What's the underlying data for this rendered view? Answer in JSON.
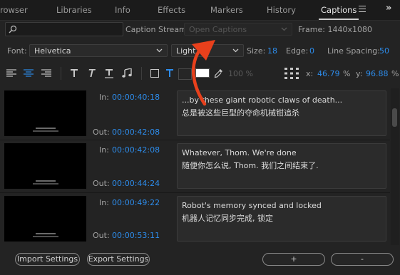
{
  "tabs": [
    {
      "label": "rowser"
    },
    {
      "label": "Libraries"
    },
    {
      "label": "Info"
    },
    {
      "label": "Effects"
    },
    {
      "label": "Markers"
    },
    {
      "label": "History"
    },
    {
      "label": "Captions"
    }
  ],
  "overflow_label": "»",
  "search": {
    "placeholder": ""
  },
  "caption_stream": {
    "label": "Caption Stream:",
    "value": "Open Captions"
  },
  "frame": {
    "label": "Frame:",
    "value": "1440x1080"
  },
  "font": {
    "label": "Font:",
    "family": "Helvetica",
    "style": "Light"
  },
  "size": {
    "label": "Size:",
    "value": "18"
  },
  "edge": {
    "label": "Edge:",
    "value": "0"
  },
  "line_spacing": {
    "label": "Line Spacing:",
    "value": "50"
  },
  "opacity": {
    "value": "100",
    "unit": "%"
  },
  "position": {
    "x_label": "x:",
    "x": "46.79",
    "x_unit": "%",
    "y_label": "y:",
    "y": "96.88",
    "y_unit": "%"
  },
  "captions": [
    {
      "in_label": "In:",
      "in": "00:00:40:18",
      "out_label": "Out:",
      "out": "00:00:42:08",
      "line1": "...by these giant robotic claws of death...",
      "line2": "总是被这些巨型的夺命机械钳追杀"
    },
    {
      "in_label": "In:",
      "in": "00:00:42:08",
      "out_label": "Out:",
      "out": "00:00:44:24",
      "line1": "Whatever, Thom. We're done",
      "line2": "随便你怎么说, Thom. 我们之间结束了."
    },
    {
      "in_label": "In:",
      "in": "00:00:49:22",
      "out_label": "Out:",
      "out": "00:00:53:11",
      "line1": "Robot's memory synced and locked",
      "line2": "机器人记忆同步完成, 锁定"
    }
  ],
  "buttons": {
    "import": "Import Settings",
    "export": "Export Settings",
    "add": "+",
    "remove": "-"
  },
  "colors": {
    "accent": "#2d8ceb",
    "annotation_arrow": "#e8401c",
    "panel_bg": "#232323"
  }
}
